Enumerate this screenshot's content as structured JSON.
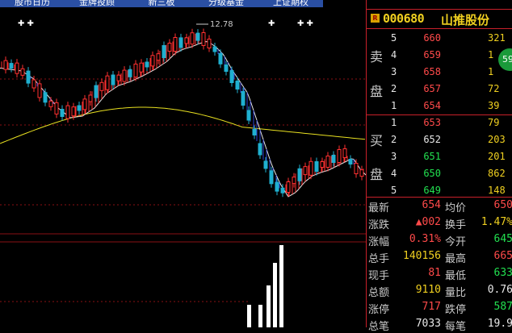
{
  "tabs": [
    {
      "label": "股市日历"
    },
    {
      "label": "金牌投顾"
    },
    {
      "label": "新三板"
    },
    {
      "label": "分级基金"
    },
    {
      "label": "上证期权"
    }
  ],
  "chart": {
    "high_marker": "12.78",
    "markers": [
      "✚ ✚",
      "✚",
      "✚ ✚"
    ]
  },
  "stock": {
    "badge": "R",
    "code": "000680",
    "name": "山推股份"
  },
  "order_book": {
    "sell_label": [
      "卖",
      "盘"
    ],
    "buy_label": [
      "买",
      "盘"
    ],
    "sells": [
      {
        "level": "5",
        "price": "660",
        "volume": "321"
      },
      {
        "level": "4",
        "price": "659",
        "volume": "1"
      },
      {
        "level": "3",
        "price": "658",
        "volume": "1"
      },
      {
        "level": "2",
        "price": "657",
        "volume": "72"
      },
      {
        "level": "1",
        "price": "654",
        "volume": "39"
      }
    ],
    "buys": [
      {
        "level": "1",
        "price": "653",
        "volume": "79"
      },
      {
        "level": "2",
        "price": "652",
        "volume": "203"
      },
      {
        "level": "3",
        "price": "651",
        "volume": "201"
      },
      {
        "level": "4",
        "price": "650",
        "volume": "862"
      },
      {
        "level": "5",
        "price": "649",
        "volume": "148"
      }
    ],
    "float_badge": "59"
  },
  "quote": [
    {
      "l": "最新",
      "v": "654",
      "vc": "red",
      "r": "均价",
      "v2": "650",
      "v2c": "red"
    },
    {
      "l": "涨跌",
      "v": "▲002",
      "vc": "red",
      "r": "换手",
      "v2": "1.47%",
      "v2c": "yel"
    },
    {
      "l": "涨幅",
      "v": "0.31%",
      "vc": "red",
      "r": "今开",
      "v2": "645",
      "v2c": "grn"
    },
    {
      "l": "总手",
      "v": "140156",
      "vc": "yel",
      "r": "最高",
      "v2": "665",
      "v2c": "red"
    },
    {
      "l": "现手",
      "v": "81",
      "vc": "red",
      "r": "最低",
      "v2": "633",
      "v2c": "grn"
    },
    {
      "l": "总额",
      "v": "9110",
      "vc": "yel",
      "r": "量比",
      "v2": "0.76",
      "v2c": "wht"
    },
    {
      "l": "涨停",
      "v": "717",
      "vc": "red",
      "r": "跌停",
      "v2": "587",
      "v2c": "grn"
    },
    {
      "l": "总笔",
      "v": "7033",
      "vc": "wht",
      "r": "每笔",
      "v2": "19.9",
      "v2c": "wht"
    }
  ],
  "colors": {
    "up": "#ff3030",
    "down": "#1fb0d0",
    "ma_slow": "#e8e020",
    "ma_fast": "#e8e8e8",
    "grid": "#8a1015"
  }
}
